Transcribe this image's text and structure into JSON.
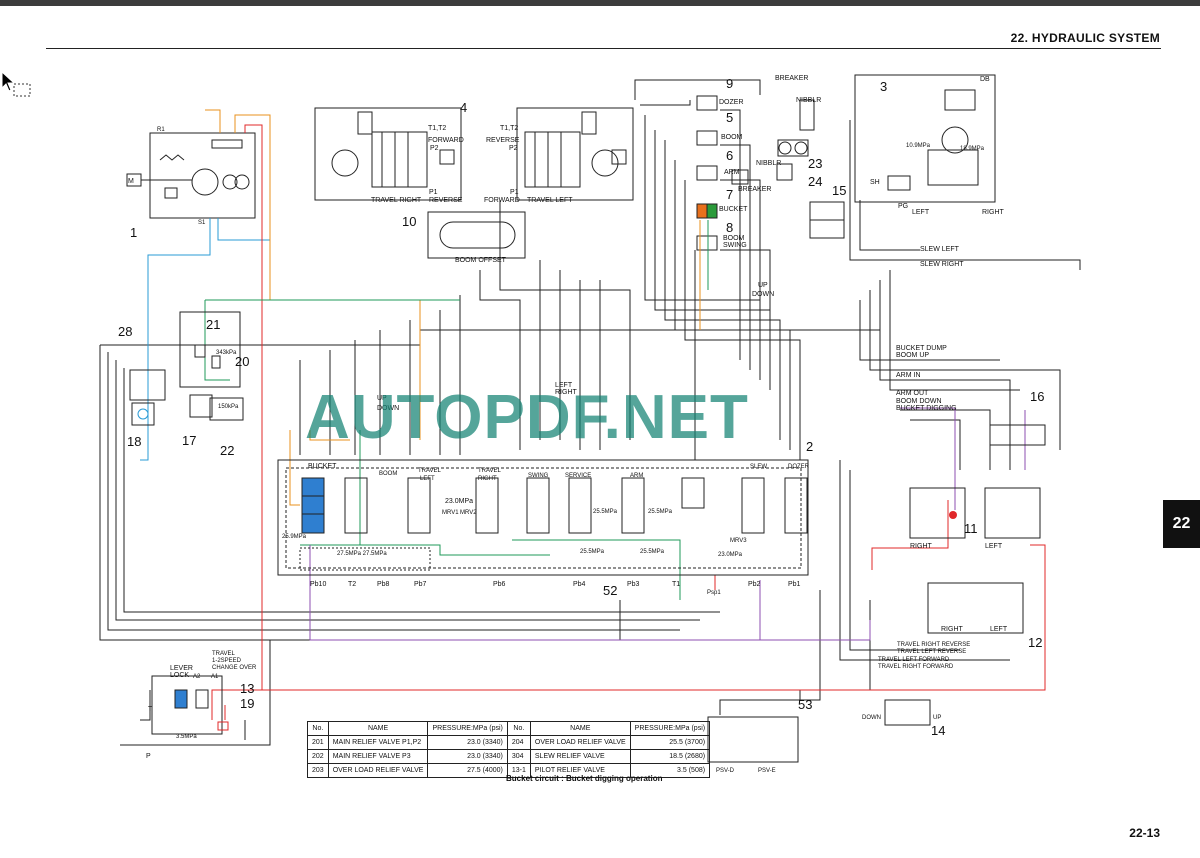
{
  "header": {
    "chapter_title": "22. HYDRAULIC SYSTEM",
    "page_number": "22-13",
    "chapter_tab": "22"
  },
  "watermark": "AUTOPDF.NET",
  "caption": "Bucket circuit : Bucket digging operation",
  "callouts": {
    "c1": "1",
    "c2": "2",
    "c3": "3",
    "c4": "4",
    "c5": "5",
    "c6": "6",
    "c7": "7",
    "c8": "8",
    "c9": "9",
    "c10": "10",
    "c11": "11",
    "c12": "12",
    "c13": "13",
    "c14": "14",
    "c15": "15",
    "c16": "16",
    "c17": "17",
    "c18": "18",
    "c19": "19",
    "c20": "20",
    "c21": "21",
    "c22": "22",
    "c23": "23",
    "c24": "24",
    "c28": "28",
    "c52": "52",
    "c53": "53"
  },
  "labels": {
    "dozer": "DOZER",
    "boom": "BOOM",
    "arm": "ARM",
    "bucket": "BUCKET",
    "boom_swing": "BOOM",
    "swing": "SWING",
    "breaker": "BREAKER",
    "breaker2": "BREAKER",
    "nibblr": "NIBBLR",
    "nibblr2": "NIBBLR",
    "travel_right": "TRAVEL RIGHT",
    "travel_left": "TRAVEL LEFT",
    "forward": "FORWARD",
    "reverse": "REVERSE",
    "p1": "P1",
    "p2": "P2",
    "p1r": "P1",
    "p2r": "P2",
    "reverse_b": "REVERSE",
    "forward_b": "FORWARD",
    "t1t2a": "T1,T2",
    "t1t2b": "T1,T2",
    "boom_offset": "BOOM OFFSET",
    "slew_left": "SLEW LEFT",
    "slew_right": "SLEW RIGHT",
    "up": "UP",
    "down": "DOWN",
    "bucket_dump": "BUCKET DUMP",
    "boom_up": "BOOM UP",
    "arm_in": "ARM IN",
    "arm_out": "ARM OUT",
    "boom_down": "BOOM DOWN",
    "bucket_digging": "BUCKET DIGGING",
    "left": "LEFT",
    "right": "RIGHT",
    "mpa_23": "23.0MPa",
    "mpa_255": "25.5MPa",
    "mpa_255b": "25.5MPa",
    "mpa_255c": "25.5MPa",
    "mpa_255d": "25.5MPa",
    "mpa_259": "25.9MPa",
    "mpa_275": "27.5MPa 27.5MPa",
    "mpa_230b": "23.0MPa",
    "mpa_35": "3.5MPa",
    "kpa_343": "343kPa",
    "kpa_150": "150kPa",
    "mrv1": "MRV1",
    "mrv2": "MRV2",
    "mrv3": "MRV3",
    "pb10": "Pb10",
    "t2": "T2",
    "pb8": "Pb8",
    "pb7": "Pb7",
    "pb6": "Pb6",
    "pb4": "Pb4",
    "pb3": "Pb3",
    "t1": "T1",
    "pb2": "Pb2",
    "pb1": "Pb1",
    "psp1": "Psp1",
    "lever_lock": "LEVER",
    "lever_lock2": "LOCK",
    "travel_speed": "TRAVEL",
    "travel_speed2": "1-2SPEED",
    "travel_speed3": "CHANGE OVER",
    "tr_rev": "TRAVEL RIGHT REVERSE",
    "tl_rev": "TRAVEL LEFT REVERSE",
    "tl_fwd": "TRAVEL LEFT FORWARD",
    "tr_fwd": "TRAVEL RIGHT FORWARD",
    "psv_d": "PSV-D",
    "psv_e": "PSV-E",
    "a1": "A1",
    "a2": "A2",
    "p": "P",
    "t": "T",
    "m": "M",
    "s1": "S1",
    "r1": "R1",
    "db": "DB",
    "pg": "PG",
    "sh": "SH",
    "mpa_109": "10.9MPa",
    "mpa_189": "18.9MPa",
    "travel_label": "TRAVEL",
    "left_label": "LEFT",
    "slew_label": "SLEW",
    "dozer_label": "DOZER",
    "service": "SERVICE",
    "swing_label": "SWING",
    "arm_label": "ARM",
    "boom_label": "BOOM",
    "bucket_label": "BUCKET",
    "right_label": "RIGHT"
  },
  "spec_table": {
    "headers": [
      "No.",
      "NAME",
      "PRESSURE:MPa (psi)",
      "No.",
      "NAME",
      "PRESSURE:MPa (psi)"
    ],
    "rows": [
      [
        "201",
        "MAIN RELIEF VALVE P1,P2",
        "23.0 (3340)",
        "204",
        "OVER LOAD RELIEF VALVE",
        "25.5 (3700)"
      ],
      [
        "202",
        "MAIN RELIEF VALVE P3",
        "23.0 (3340)",
        "304",
        "SLEW RELIEF VALVE",
        "18.5 (2680)"
      ],
      [
        "203",
        "OVER LOAD RELIEF VALVE",
        "27.5 (4000)",
        "13-1",
        "PILOT RELIEF VALVE",
        "3.5 (508)"
      ]
    ]
  },
  "colors": {
    "pilot_blue": "#2a9bd6",
    "pilot_orange": "#e8901c",
    "pressure_red": "#e0282a",
    "return_green": "#1f9a5a",
    "drain_purple": "#8e4fb0",
    "spool_blue": "#2f7fd0",
    "valve_orange": "#e8701c",
    "valve_green": "#2a9a3a",
    "watermark": "#14826f"
  }
}
